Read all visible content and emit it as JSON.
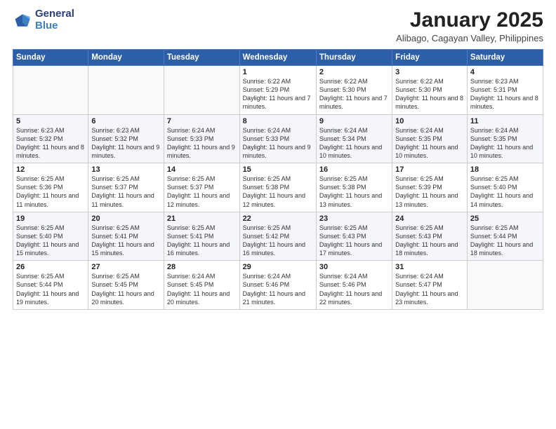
{
  "header": {
    "logo_general": "General",
    "logo_blue": "Blue",
    "month_title": "January 2025",
    "location": "Alibago, Cagayan Valley, Philippines"
  },
  "weekdays": [
    "Sunday",
    "Monday",
    "Tuesday",
    "Wednesday",
    "Thursday",
    "Friday",
    "Saturday"
  ],
  "weeks": [
    [
      {
        "day": "",
        "sunrise": "",
        "sunset": "",
        "daylight": ""
      },
      {
        "day": "",
        "sunrise": "",
        "sunset": "",
        "daylight": ""
      },
      {
        "day": "",
        "sunrise": "",
        "sunset": "",
        "daylight": ""
      },
      {
        "day": "1",
        "sunrise": "Sunrise: 6:22 AM",
        "sunset": "Sunset: 5:29 PM",
        "daylight": "Daylight: 11 hours and 7 minutes."
      },
      {
        "day": "2",
        "sunrise": "Sunrise: 6:22 AM",
        "sunset": "Sunset: 5:30 PM",
        "daylight": "Daylight: 11 hours and 7 minutes."
      },
      {
        "day": "3",
        "sunrise": "Sunrise: 6:22 AM",
        "sunset": "Sunset: 5:30 PM",
        "daylight": "Daylight: 11 hours and 8 minutes."
      },
      {
        "day": "4",
        "sunrise": "Sunrise: 6:23 AM",
        "sunset": "Sunset: 5:31 PM",
        "daylight": "Daylight: 11 hours and 8 minutes."
      }
    ],
    [
      {
        "day": "5",
        "sunrise": "Sunrise: 6:23 AM",
        "sunset": "Sunset: 5:32 PM",
        "daylight": "Daylight: 11 hours and 8 minutes."
      },
      {
        "day": "6",
        "sunrise": "Sunrise: 6:23 AM",
        "sunset": "Sunset: 5:32 PM",
        "daylight": "Daylight: 11 hours and 9 minutes."
      },
      {
        "day": "7",
        "sunrise": "Sunrise: 6:24 AM",
        "sunset": "Sunset: 5:33 PM",
        "daylight": "Daylight: 11 hours and 9 minutes."
      },
      {
        "day": "8",
        "sunrise": "Sunrise: 6:24 AM",
        "sunset": "Sunset: 5:33 PM",
        "daylight": "Daylight: 11 hours and 9 minutes."
      },
      {
        "day": "9",
        "sunrise": "Sunrise: 6:24 AM",
        "sunset": "Sunset: 5:34 PM",
        "daylight": "Daylight: 11 hours and 10 minutes."
      },
      {
        "day": "10",
        "sunrise": "Sunrise: 6:24 AM",
        "sunset": "Sunset: 5:35 PM",
        "daylight": "Daylight: 11 hours and 10 minutes."
      },
      {
        "day": "11",
        "sunrise": "Sunrise: 6:24 AM",
        "sunset": "Sunset: 5:35 PM",
        "daylight": "Daylight: 11 hours and 10 minutes."
      }
    ],
    [
      {
        "day": "12",
        "sunrise": "Sunrise: 6:25 AM",
        "sunset": "Sunset: 5:36 PM",
        "daylight": "Daylight: 11 hours and 11 minutes."
      },
      {
        "day": "13",
        "sunrise": "Sunrise: 6:25 AM",
        "sunset": "Sunset: 5:37 PM",
        "daylight": "Daylight: 11 hours and 11 minutes."
      },
      {
        "day": "14",
        "sunrise": "Sunrise: 6:25 AM",
        "sunset": "Sunset: 5:37 PM",
        "daylight": "Daylight: 11 hours and 12 minutes."
      },
      {
        "day": "15",
        "sunrise": "Sunrise: 6:25 AM",
        "sunset": "Sunset: 5:38 PM",
        "daylight": "Daylight: 11 hours and 12 minutes."
      },
      {
        "day": "16",
        "sunrise": "Sunrise: 6:25 AM",
        "sunset": "Sunset: 5:38 PM",
        "daylight": "Daylight: 11 hours and 13 minutes."
      },
      {
        "day": "17",
        "sunrise": "Sunrise: 6:25 AM",
        "sunset": "Sunset: 5:39 PM",
        "daylight": "Daylight: 11 hours and 13 minutes."
      },
      {
        "day": "18",
        "sunrise": "Sunrise: 6:25 AM",
        "sunset": "Sunset: 5:40 PM",
        "daylight": "Daylight: 11 hours and 14 minutes."
      }
    ],
    [
      {
        "day": "19",
        "sunrise": "Sunrise: 6:25 AM",
        "sunset": "Sunset: 5:40 PM",
        "daylight": "Daylight: 11 hours and 15 minutes."
      },
      {
        "day": "20",
        "sunrise": "Sunrise: 6:25 AM",
        "sunset": "Sunset: 5:41 PM",
        "daylight": "Daylight: 11 hours and 15 minutes."
      },
      {
        "day": "21",
        "sunrise": "Sunrise: 6:25 AM",
        "sunset": "Sunset: 5:41 PM",
        "daylight": "Daylight: 11 hours and 16 minutes."
      },
      {
        "day": "22",
        "sunrise": "Sunrise: 6:25 AM",
        "sunset": "Sunset: 5:42 PM",
        "daylight": "Daylight: 11 hours and 16 minutes."
      },
      {
        "day": "23",
        "sunrise": "Sunrise: 6:25 AM",
        "sunset": "Sunset: 5:43 PM",
        "daylight": "Daylight: 11 hours and 17 minutes."
      },
      {
        "day": "24",
        "sunrise": "Sunrise: 6:25 AM",
        "sunset": "Sunset: 5:43 PM",
        "daylight": "Daylight: 11 hours and 18 minutes."
      },
      {
        "day": "25",
        "sunrise": "Sunrise: 6:25 AM",
        "sunset": "Sunset: 5:44 PM",
        "daylight": "Daylight: 11 hours and 18 minutes."
      }
    ],
    [
      {
        "day": "26",
        "sunrise": "Sunrise: 6:25 AM",
        "sunset": "Sunset: 5:44 PM",
        "daylight": "Daylight: 11 hours and 19 minutes."
      },
      {
        "day": "27",
        "sunrise": "Sunrise: 6:25 AM",
        "sunset": "Sunset: 5:45 PM",
        "daylight": "Daylight: 11 hours and 20 minutes."
      },
      {
        "day": "28",
        "sunrise": "Sunrise: 6:24 AM",
        "sunset": "Sunset: 5:45 PM",
        "daylight": "Daylight: 11 hours and 20 minutes."
      },
      {
        "day": "29",
        "sunrise": "Sunrise: 6:24 AM",
        "sunset": "Sunset: 5:46 PM",
        "daylight": "Daylight: 11 hours and 21 minutes."
      },
      {
        "day": "30",
        "sunrise": "Sunrise: 6:24 AM",
        "sunset": "Sunset: 5:46 PM",
        "daylight": "Daylight: 11 hours and 22 minutes."
      },
      {
        "day": "31",
        "sunrise": "Sunrise: 6:24 AM",
        "sunset": "Sunset: 5:47 PM",
        "daylight": "Daylight: 11 hours and 23 minutes."
      },
      {
        "day": "",
        "sunrise": "",
        "sunset": "",
        "daylight": ""
      }
    ]
  ]
}
